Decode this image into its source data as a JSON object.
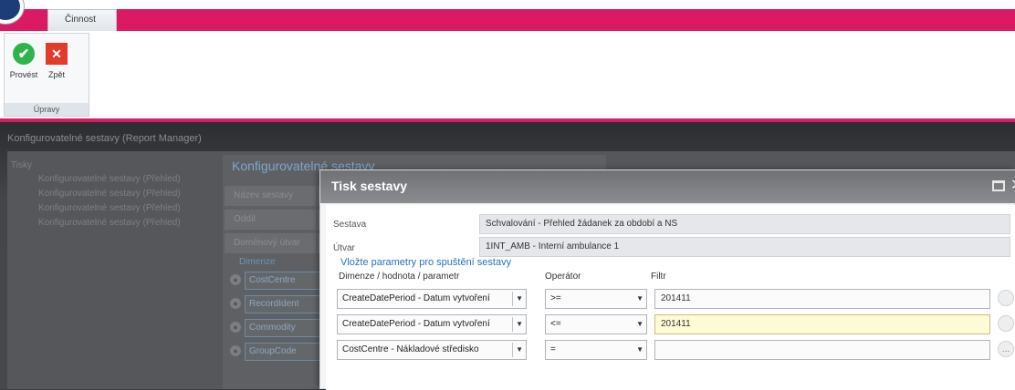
{
  "ribbon": {
    "tab_label": "Činnost",
    "buttons": {
      "provest": "Provést",
      "zpet": "Zpět"
    },
    "group_label": "Úpravy"
  },
  "workspace": {
    "outer_title": "Konfigurovatelné sestavy (Report Manager)",
    "tree": {
      "root": "Tisky",
      "items": [
        "Konfigurovatelné sestavy (Přehled)",
        "Konfigurovatelné sestavy (Přehled)",
        "Konfigurovatelné sestavy (Přehled)",
        "Konfigurovatelné sestavy (Přehled)"
      ]
    },
    "config_panel": {
      "title": "Konfigurovatelné sestavy",
      "fields": [
        "Název sestavy",
        "Oddíl",
        "Doménový útvar"
      ],
      "dimension_heading": "Dimenze",
      "dimensions": [
        "CostCentre",
        "RecordIdent",
        "Commodity",
        "GroupCode"
      ]
    }
  },
  "dialog": {
    "title": "Tisk sestavy",
    "sestava_label": "Sestava",
    "sestava_value": "Schvalování - Přehled žádanek za období a NS",
    "utvar_label": "Útvar",
    "utvar_value": "1INT_AMB - Interní ambulance 1",
    "params_heading": "Vložte parametry pro spuštění sestavy",
    "columns": {
      "dimension": "Dimenze / hodnota / parametr",
      "operator": "Operátor",
      "filter": "Filtr"
    },
    "rows": [
      {
        "dimension": "CreateDatePeriod - Datum vytvoření",
        "operator": ">=",
        "filter": "201411"
      },
      {
        "dimension": "CreateDatePeriod - Datum vytvoření",
        "operator": "<=",
        "filter": "201411"
      },
      {
        "dimension": "CostCentre - Nákladové středisko",
        "operator": "=",
        "filter": ""
      }
    ]
  },
  "colors": {
    "brand_pink": "#dc1a64",
    "ok_green": "#2fb44a",
    "cancel_red": "#e23b2e",
    "link_blue": "#2a6fc4",
    "active_field": "#fdfbd6"
  },
  "icons": [
    "app-logo-icon",
    "ok-check-icon",
    "cancel-x-icon",
    "maximize-icon",
    "close-icon",
    "lock-icon",
    "dropdown-arrow-icon"
  ]
}
